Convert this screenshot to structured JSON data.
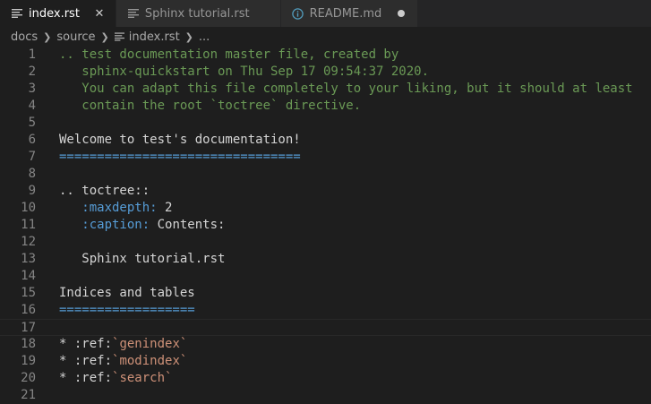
{
  "tabs": [
    {
      "label": "index.rst",
      "icon": "lines-icon",
      "active": true,
      "close": "✕"
    },
    {
      "label": "Sphinx tutorial.rst",
      "icon": "lines-icon",
      "active": false
    },
    {
      "label": "README.md",
      "icon": "info-icon",
      "active": false,
      "dirty": true
    }
  ],
  "breadcrumb": [
    "docs",
    "source",
    "index.rst",
    "..."
  ],
  "colors": {
    "comment": "#6a9955",
    "underline": "#569cd6",
    "role": "#ce9178",
    "line_number": "#858585",
    "background": "#1e1e1e"
  },
  "lines": {
    "l1": ".. test documentation master file, created by",
    "l2": "   sphinx-quickstart on Thu Sep 17 09:54:37 2020.",
    "l3": "   You can adapt this file completely to your liking, but it should at least",
    "l4": "   contain the root `toctree` directive.",
    "l5": "",
    "l6": "Welcome to test's documentation!",
    "l7": "================================",
    "l8": "",
    "l9": ".. toctree::",
    "l10_field": "   :maxdepth:",
    "l10_value": " 2",
    "l11_field": "   :caption:",
    "l11_value": " Contents:",
    "l12": "",
    "l13": "   Sphinx tutorial.rst",
    "l14": "",
    "l15": "Indices and tables",
    "l16": "==================",
    "l17": "",
    "l18_pre": "* :ref:",
    "l18_role": "`genindex`",
    "l19_pre": "* :ref:",
    "l19_role": "`modindex`",
    "l20_pre": "* :ref:",
    "l20_role": "`search`",
    "l21": ""
  },
  "line_numbers": [
    "1",
    "2",
    "3",
    "4",
    "5",
    "6",
    "7",
    "8",
    "9",
    "10",
    "11",
    "12",
    "13",
    "14",
    "15",
    "16",
    "17",
    "18",
    "19",
    "20",
    "21"
  ]
}
